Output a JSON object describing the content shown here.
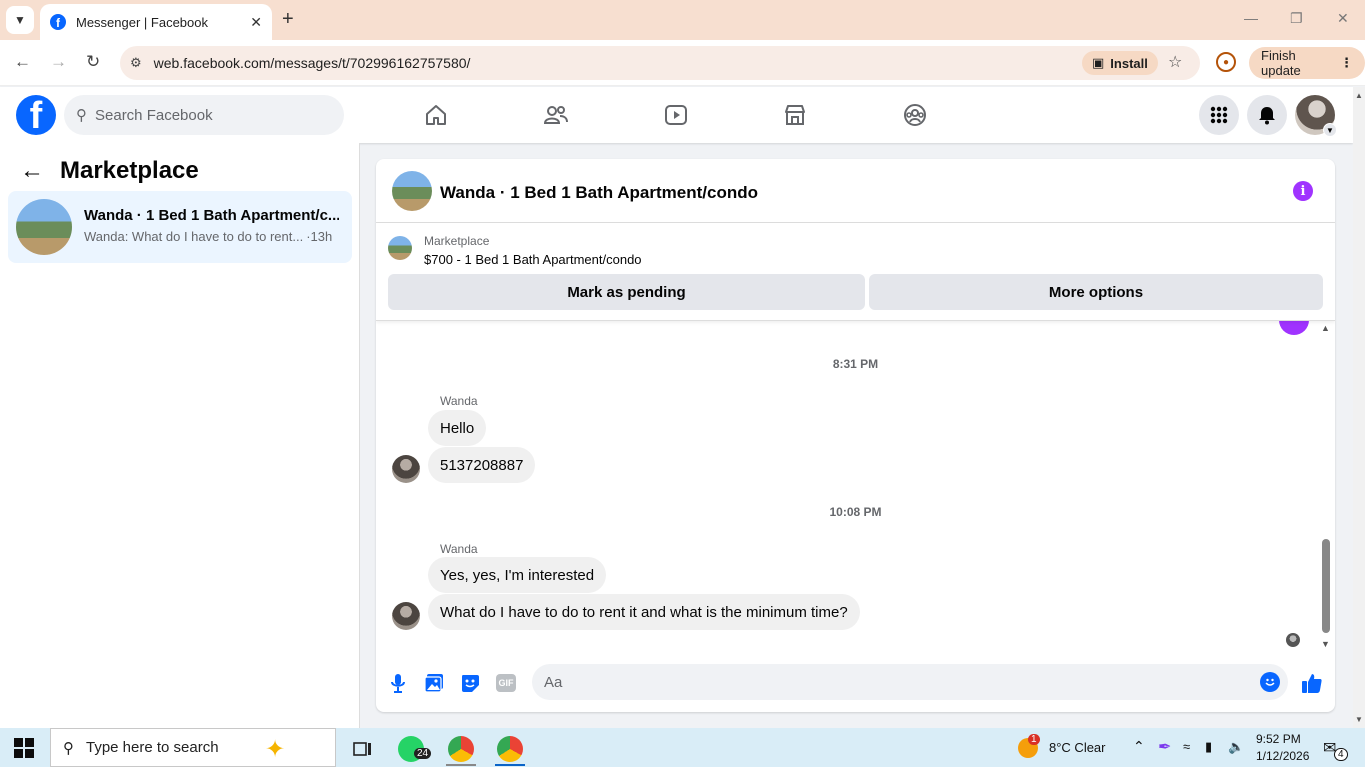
{
  "browser": {
    "tab_title": "Messenger | Facebook",
    "url": "web.facebook.com/messages/t/702996162757580/",
    "install_label": "Install",
    "finish_update_label": "Finish update"
  },
  "header": {
    "logo": "f",
    "search_placeholder": "Search Facebook",
    "nav_icons": [
      "home-icon",
      "friends-icon",
      "video-icon",
      "marketplace-icon",
      "groups-icon"
    ]
  },
  "sidebar": {
    "title": "Marketplace",
    "conversation": {
      "name": "Wanda · 1 Bed 1 Bath Apartment/c...",
      "snippet": "Wanda: What do I have to do to rent...",
      "time": "·13h"
    }
  },
  "chat": {
    "title": "Wanda · 1 Bed 1 Bath Apartment/condo",
    "listing": {
      "label": "Marketplace",
      "price_title": "$700 - 1 Bed 1 Bath Apartment/condo",
      "mark_pending": "Mark as pending",
      "more_options": "More options"
    },
    "groups": [
      {
        "time": "8:31 PM",
        "sender": "Wanda",
        "messages": [
          "Hello",
          "5137208887"
        ]
      },
      {
        "time": "10:08 PM",
        "sender": "Wanda",
        "messages": [
          "Yes, yes, I'm interested",
          "What do I have to do to rent it and what is the minimum time?"
        ]
      }
    ],
    "composer_placeholder": "Aa",
    "gif_label": "GIF"
  },
  "taskbar": {
    "search_text": "Type here to search",
    "whatsapp_badge": "24",
    "weather_badge": "1",
    "weather": "8°C  Clear",
    "time": "9:52 PM",
    "date": "1/12/2026",
    "notif_badge": "4"
  },
  "colors": {
    "facebook_blue": "#0866ff",
    "messenger_purple": "#a033ff",
    "selected_conversation": "#ebf5ff",
    "bubble": "#f0f0f0"
  }
}
